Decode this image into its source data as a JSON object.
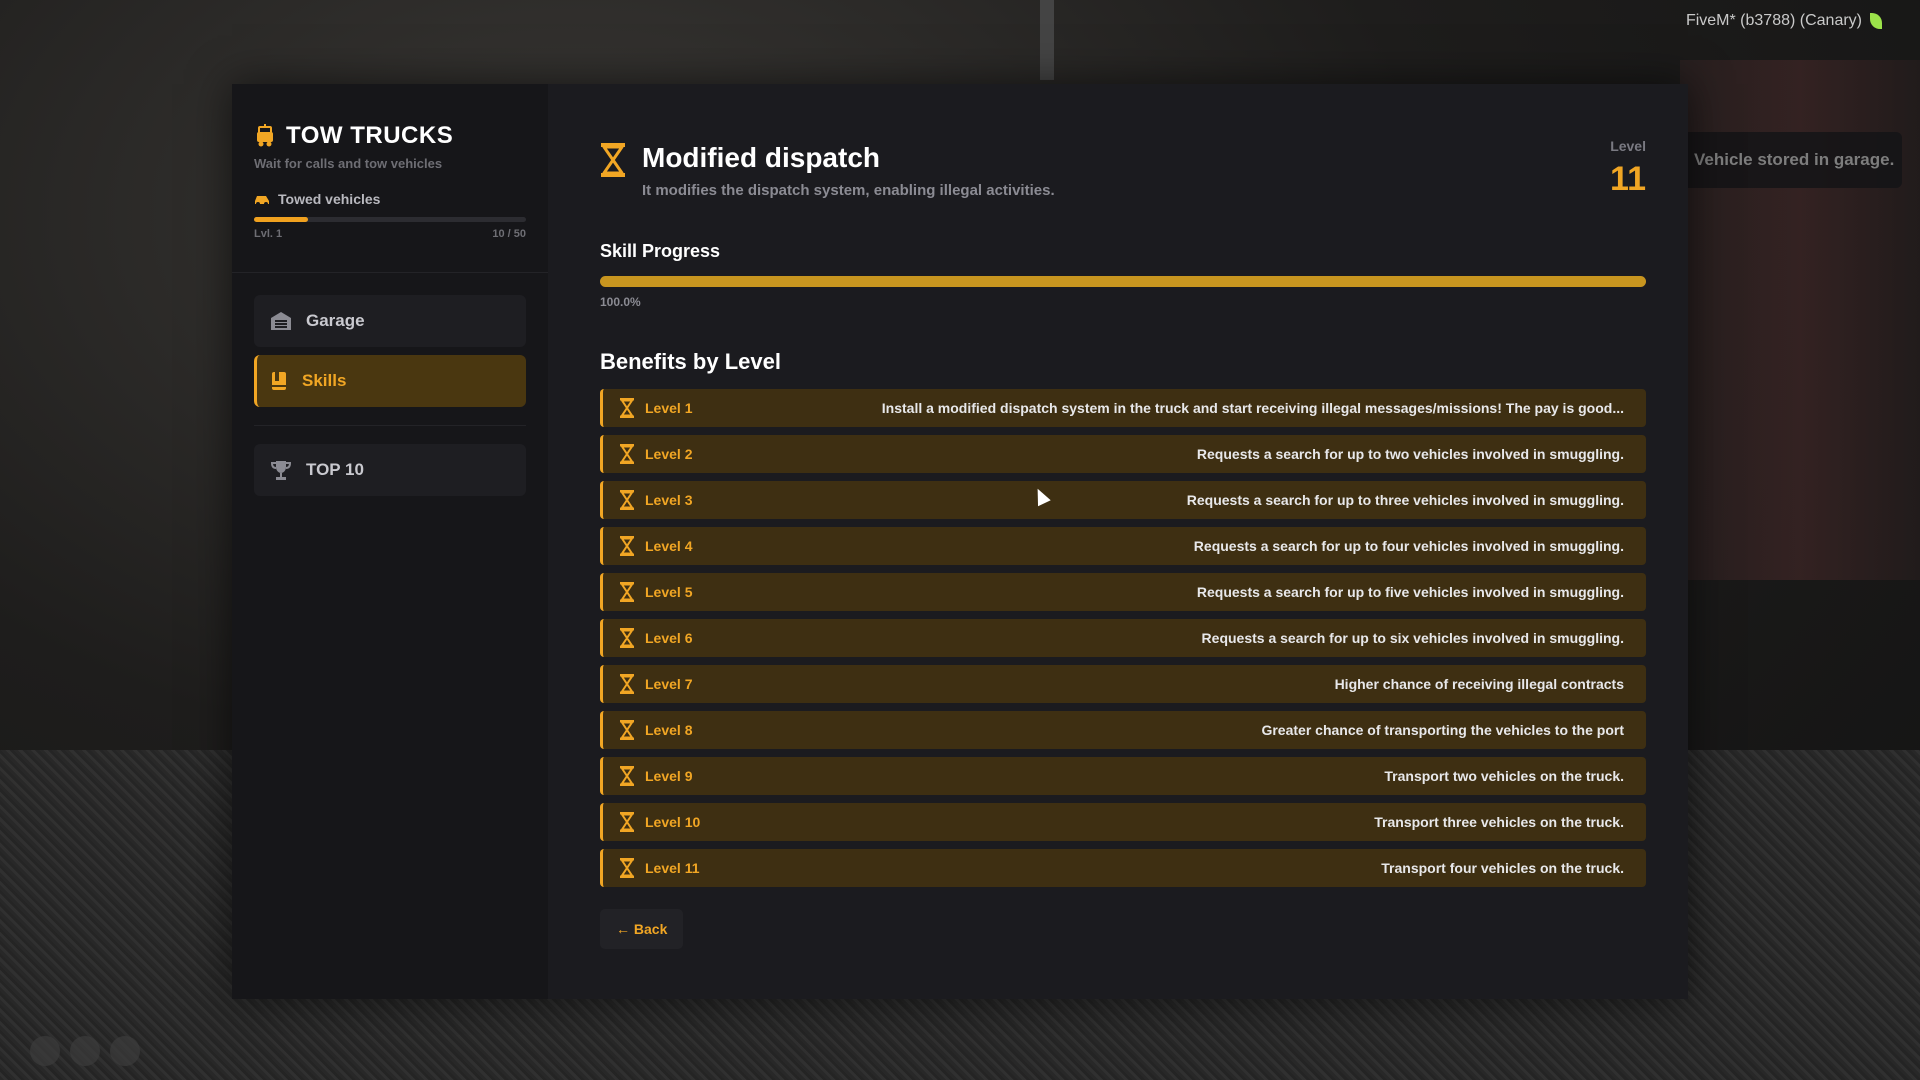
{
  "app": {
    "title": "TOW TRUCKS",
    "subtitle": "Wait for calls and tow vehicles",
    "accent": "#f1a624"
  },
  "overlay": {
    "client": "FiveM* (b3788) (Canary)",
    "toast": "Vehicle stored in garage."
  },
  "progress": {
    "label": "Towed vehicles",
    "level": "Lvl. 1",
    "count": "10 / 50",
    "fraction": 0.2
  },
  "nav": [
    {
      "label": "Garage",
      "icon": "garage-icon",
      "active": false
    },
    {
      "label": "Skills",
      "icon": "book-icon",
      "active": true
    },
    {
      "label": "TOP 10",
      "icon": "trophy-icon",
      "active": false
    }
  ],
  "skill": {
    "name": "Modified dispatch",
    "description": "It modifies the dispatch system, enabling illegal activities.",
    "level_label": "Level",
    "level_value": "11",
    "progress_title": "Skill Progress",
    "progress_percent_text": "100.0%",
    "progress_fraction": 1.0
  },
  "benefits": {
    "title": "Benefits by Level",
    "rows": [
      {
        "level": "Level 1",
        "text": "Install a modified dispatch system in the truck and start receiving illegal messages/missions! The pay is good..."
      },
      {
        "level": "Level 2",
        "text": "Requests a search for up to two vehicles involved in smuggling."
      },
      {
        "level": "Level 3",
        "text": "Requests a search for up to three vehicles involved in smuggling."
      },
      {
        "level": "Level 4",
        "text": "Requests a search for up to four vehicles involved in smuggling."
      },
      {
        "level": "Level 5",
        "text": "Requests a search for up to five vehicles involved in smuggling."
      },
      {
        "level": "Level 6",
        "text": "Requests a search for up to six vehicles involved in smuggling."
      },
      {
        "level": "Level 7",
        "text": "Higher chance of receiving illegal contracts"
      },
      {
        "level": "Level 8",
        "text": "Greater chance of transporting the vehicles to the port"
      },
      {
        "level": "Level 9",
        "text": "Transport two vehicles on the truck."
      },
      {
        "level": "Level 10",
        "text": "Transport three vehicles on the truck."
      },
      {
        "level": "Level 11",
        "text": "Transport four vehicles on the truck."
      }
    ]
  },
  "actions": {
    "back_label": "← Back"
  }
}
